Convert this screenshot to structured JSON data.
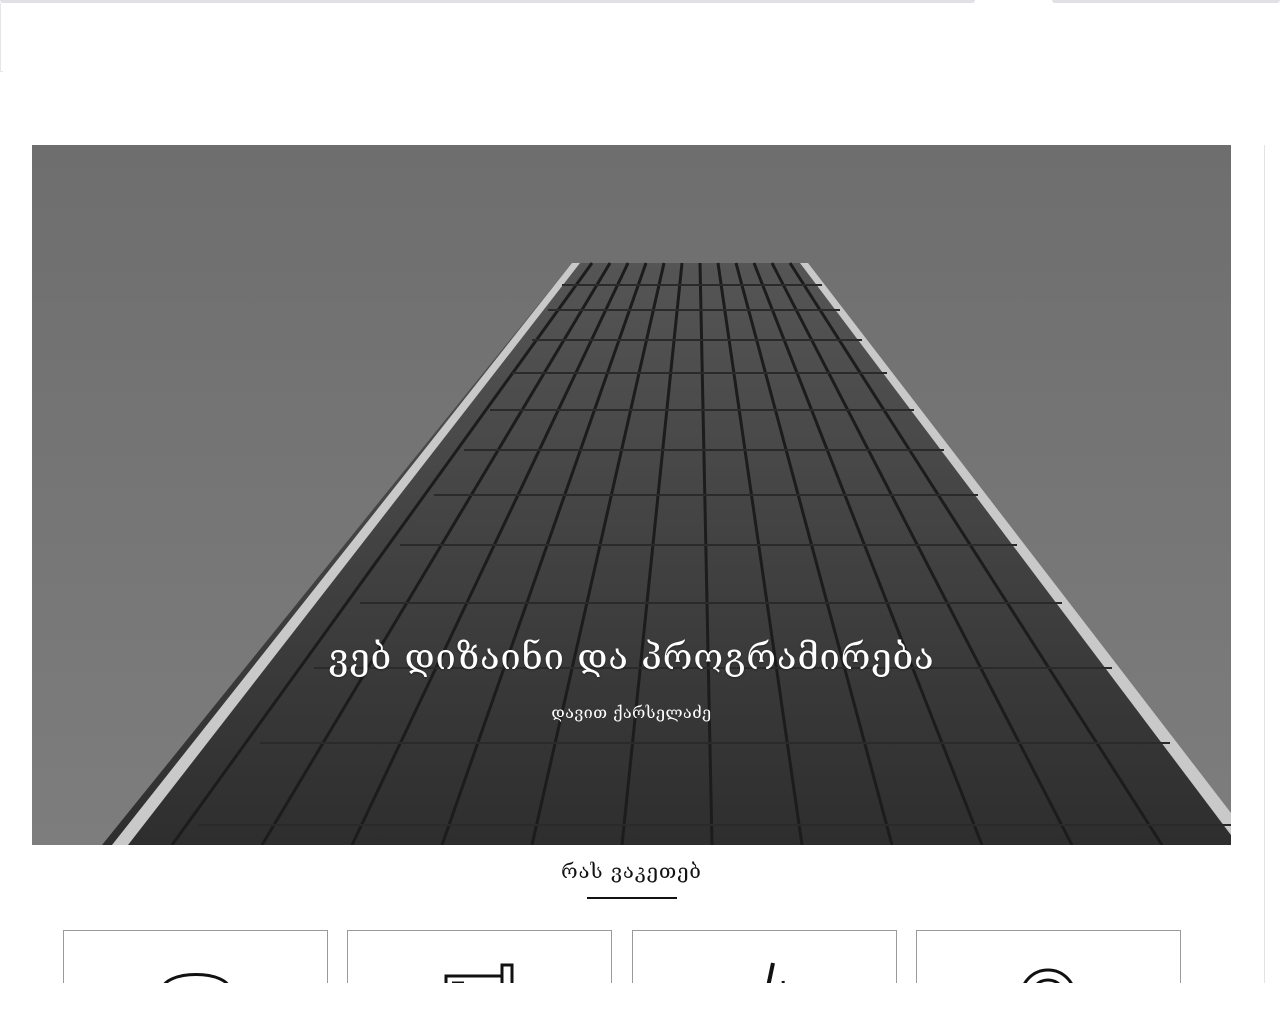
{
  "hero": {
    "title": "ვებ დიზაინი და პროგრამირება",
    "subtitle": "დავით ქარსელაძე"
  },
  "services": {
    "title": "რას ვაკეთებ",
    "cards": [
      {
        "icon": "bubble-icon"
      },
      {
        "icon": "tools-icon"
      },
      {
        "icon": "brush-icon"
      },
      {
        "icon": "at-icon"
      }
    ]
  },
  "colors": {
    "hero_sky": "#7a7a7a",
    "building": "#3a3a3a",
    "accent": "#111111"
  }
}
